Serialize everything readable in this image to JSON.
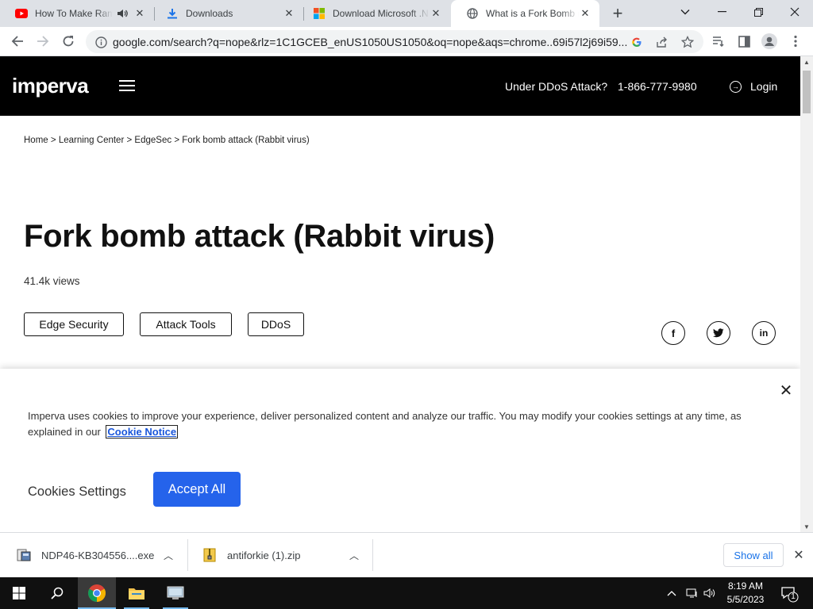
{
  "browser": {
    "tabs": [
      {
        "title": "How To Make Ram",
        "icon": "youtube-icon",
        "active": false
      },
      {
        "title": "Downloads",
        "icon": "download-icon",
        "active": false
      },
      {
        "title": "Download Microsoft .N",
        "icon": "microsoft-icon",
        "active": false
      },
      {
        "title": "What is a Fork Bomb (F",
        "icon": "globe-icon",
        "active": true
      }
    ],
    "url": "google.com/search?q=nope&rlz=1C1GCEB_enUS1050US1050&oq=nope&aqs=chrome..69i57l2j69i59..."
  },
  "site": {
    "logo": "imperva",
    "ddos_link": "Under DDoS Attack?",
    "phone": "1-866-777-9980",
    "login": "Login"
  },
  "breadcrumb": {
    "items": [
      "Home",
      "Learning Center",
      "EdgeSec",
      "Fork bomb attack (Rabbit virus)"
    ],
    "separator": ">"
  },
  "article": {
    "title": "Fork bomb attack (Rabbit virus)",
    "views": "41.4k views",
    "tags": [
      "Edge Security",
      "Attack Tools",
      "DDoS"
    ],
    "share_icons": [
      "facebook-icon",
      "twitter-icon",
      "linkedin-icon"
    ]
  },
  "cookie_banner": {
    "text": "Imperva uses cookies to improve your experience, deliver personalized content and analyze our traffic. You may modify your cookies settings at any time, as explained in our",
    "link": "Cookie Notice",
    "settings_label": "Cookies Settings",
    "accept_label": "Accept All",
    "accent_color": "#2563eb"
  },
  "downloads": {
    "items": [
      {
        "name": "NDP46-KB304556....exe",
        "icon": "installer-icon"
      },
      {
        "name": "antiforkie (1).zip",
        "icon": "zip-icon"
      }
    ],
    "show_all": "Show all"
  },
  "taskbar": {
    "time": "8:19 AM",
    "date": "5/5/2023",
    "notification_count": "1"
  }
}
